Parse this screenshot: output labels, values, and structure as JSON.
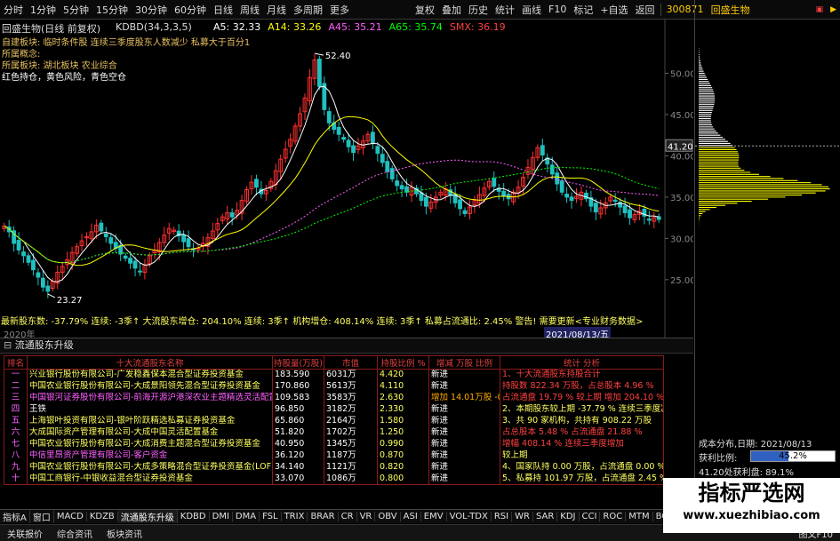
{
  "toolbar": {
    "periods": [
      "分时",
      "1分钟",
      "5分钟",
      "15分钟",
      "30分钟",
      "60分钟",
      "日线",
      "周线",
      "月线",
      "多周期",
      "更多"
    ],
    "actions": [
      "复权",
      "叠加",
      "历史",
      "统计",
      "画线",
      "F10",
      "标记",
      "+自选",
      "返回"
    ]
  },
  "stock": {
    "code": "300871",
    "name": "回盛生物"
  },
  "chart_info": {
    "main_title": "回盛生物(日线 前复权)",
    "indicator": "KDBD(34,3,3,5)",
    "ma": [
      {
        "label": "A5: 32.33",
        "color": "#ffffff"
      },
      {
        "label": "A14: 33.26",
        "color": "#ffff00"
      },
      {
        "label": "A45: 35.21",
        "color": "#ff60ff"
      },
      {
        "label": "A65: 35.74",
        "color": "#00ff00"
      },
      {
        "label": "SMX: 36.19",
        "color": "#ff4040"
      }
    ],
    "notes": [
      {
        "text": "自建板块: 临时条件股 连续三季度股东人数减少 私募大于百分1",
        "color": "#e8c060"
      },
      {
        "text": "所属概念:",
        "color": "#e8c060"
      },
      {
        "text": "所属板块: 湖北板块 农业综合",
        "color": "#e8c060"
      },
      {
        "text": "红色持仓，黄色风险，青色空仓",
        "color": "#ffffff"
      }
    ],
    "high_label": "52.40",
    "low_label": "23.27",
    "current_price_label": "41.20",
    "bottom_line": "最新股东数: -37.79% 连续: -3季↑ 大流股东增仓: 204.10% 连续: 3季↑ 机构增仓: 408.14% 连续: 3季↑ 私募占流通比: 2.45% 警告! 需要更新<专业财务数据>",
    "year_label": "2020年",
    "date_label": "2021/08/13/五"
  },
  "chart_data": {
    "type": "candlestick",
    "y_ticks": [
      25.0,
      30.0,
      35.0,
      40.0,
      45.0,
      50.0
    ],
    "ylim": [
      21,
      55
    ],
    "high": 52.4,
    "low": 23.27,
    "close_path": [
      31.5,
      30.8,
      29.4,
      28.6,
      27.9,
      27.1,
      26.2,
      25.3,
      24.1,
      23.6,
      24.8,
      25.9,
      26.6,
      27.4,
      28.3,
      29.0,
      29.7,
      30.2,
      30.8,
      31.6,
      30.9,
      30.2,
      29.4,
      28.8,
      28.1,
      27.6,
      27.0,
      26.4,
      26.0,
      26.8,
      27.9,
      28.6,
      29.5,
      30.4,
      31.2,
      31.0,
      30.3,
      29.6,
      29.0,
      28.6,
      28.8,
      29.4,
      30.1,
      30.9,
      31.8,
      32.6,
      33.1,
      32.6,
      33.4,
      34.6,
      35.9,
      36.8,
      36.2,
      35.4,
      35.8,
      36.9,
      38.2,
      39.6,
      40.8,
      42.0,
      43.6,
      45.1,
      47.0,
      49.5,
      51.6,
      48.4,
      45.6,
      44.0,
      43.2,
      42.6,
      42.0,
      41.1,
      40.4,
      41.2,
      41.8,
      42.6,
      41.5,
      40.3,
      39.2,
      38.1,
      37.2,
      36.4,
      36.0,
      35.6,
      36.2,
      35.4,
      34.6,
      33.9,
      34.4,
      35.0,
      35.6,
      36.0,
      35.2,
      34.3,
      33.6,
      33.0,
      33.8,
      34.6,
      35.3,
      36.1,
      36.9,
      36.3,
      35.7,
      35.1,
      34.8,
      35.6,
      36.2,
      37.4,
      38.6,
      39.8,
      41.0,
      40.1,
      39.0,
      37.8,
      36.6,
      35.6,
      35.0,
      34.6,
      35.1,
      35.6,
      34.8,
      33.9,
      33.2,
      33.7,
      34.3,
      35.0,
      34.5,
      33.8,
      33.1,
      32.5,
      32.9,
      33.3,
      32.7,
      32.2,
      32.5,
      32.3
    ],
    "volume_profile_peak": 36
  },
  "panel": {
    "title": "流通股东升级"
  },
  "holders": {
    "headers": [
      "排名",
      "十大流通股东名称",
      "持股量(万股)",
      "市值",
      "持股比例 %",
      "增减 万股 比例",
      "统计 分析"
    ],
    "rows": [
      {
        "rank": "一",
        "name": "兴业银行股份有限公司-广发稳鑫保本混合型证券投资基金",
        "name_color": "#ffff60",
        "qty": "183.590",
        "value": "6031万",
        "pct": "4.420",
        "change": "新进",
        "analysis": "1、十大流通股东持股合计",
        "analysis_color": "#ff4040"
      },
      {
        "rank": "二",
        "name": "中国农业银行股份有限公司-大成景阳领先混合型证券投资基金",
        "name_color": "#ffff60",
        "qty": "170.860",
        "value": "5613万",
        "pct": "4.110",
        "change": "新进",
        "analysis": "持股数 822.34 万股，占总股本 4.96 %",
        "analysis_color": "#ff4040"
      },
      {
        "rank": "三",
        "name": "中国银河证券股份有限公司-前海开源沪港深农业主题精选灵活配置混合型证券投资基金(LOF)",
        "name_color": "#ff60ff",
        "qty": "109.583",
        "value": "3583万",
        "pct": "2.630",
        "change": "增加 14.01万股 -0.2%",
        "analysis": "占流通盘 19.79 % 较上期 增加 204.10 % 连续",
        "analysis_color": "#ff4040"
      },
      {
        "rank": "四",
        "name": "王铁",
        "name_color": "#ffffff",
        "qty": "96.850",
        "value": "3182万",
        "pct": "2.330",
        "change": "新进",
        "analysis": "2、本期股东较上期 -37.79 % 连续三季度减少",
        "analysis_color": "#ffff60"
      },
      {
        "rank": "五",
        "name": "上海银叶投资有限公司-银叶阶跃精选私募证券投资基金",
        "name_color": "#ffff60",
        "qty": "65.860",
        "value": "2164万",
        "pct": "1.580",
        "change": "新进",
        "analysis": "3、共 90 家机构，共持有 908.22 万股",
        "analysis_color": "#ffff60"
      },
      {
        "rank": "六",
        "name": "大成国际资产管理有限公司-大成中国灵活配置基金",
        "name_color": "#ffff60",
        "qty": "51.820",
        "value": "1702万",
        "pct": "1.250",
        "change": "新进",
        "analysis": "占总股本 5.48 % 占流通盘 21.88 %",
        "analysis_color": "#ff4040"
      },
      {
        "rank": "七",
        "name": "中国农业银行股份有限公司-大成消费主题混合型证券投资基金",
        "name_color": "#ffff60",
        "qty": "40.950",
        "value": "1345万",
        "pct": "0.990",
        "change": "新进",
        "analysis": "增幅 408.14 % 连续三季度增加",
        "analysis_color": "#ff4040"
      },
      {
        "rank": "八",
        "name": "中信里昂资产管理有限公司-客户资金",
        "name_color": "#ff60ff",
        "qty": "36.120",
        "value": "1187万",
        "pct": "0.870",
        "change": "新进",
        "analysis": "较上期",
        "analysis_color": "#ffff60"
      },
      {
        "rank": "九",
        "name": "中国农业银行股份有限公司-大成多策略混合型证券投资基金(LOF)",
        "name_color": "#ffff60",
        "qty": "34.140",
        "value": "1121万",
        "pct": "0.820",
        "change": "新进",
        "analysis": "4、国家队持 0.00 万股，占流通盘 0.00 %",
        "analysis_color": "#ffff60"
      },
      {
        "rank": "十",
        "name": "中国工商银行-中银收益混合型证券投资基金",
        "name_color": "#ffff60",
        "qty": "33.070",
        "value": "1086万",
        "pct": "0.800",
        "change": "新进",
        "analysis": "5、私募持 101.97 万股，占流通盘 2.45 %",
        "analysis_color": "#ffff60"
      }
    ]
  },
  "bottom_tabs": [
    "指标A",
    "窗口",
    "MACD",
    "KDZB",
    "流通股东升级",
    "KDBD",
    "DMI",
    "DMA",
    "FSL",
    "TRIX",
    "BRAR",
    "CR",
    "VR",
    "OBV",
    "ASI",
    "EMV",
    "VOL-TDX",
    "RSI",
    "WR",
    "SAR",
    "KDJ",
    "CCI",
    "ROC",
    "MTM",
    "BOLL",
    "PSY",
    "MCST",
    "指标B",
    "模板"
  ],
  "status": {
    "left": [
      "关联报价",
      "综合资讯",
      "板块资讯"
    ],
    "right": "图文F10"
  },
  "right_panel": {
    "cost_date_label": "成本分布,日期: 2021/08/13",
    "profit_ratio_label": "获利比例:",
    "profit_ratio_value": "45.2%",
    "profit_at_label": "41.20处获利盘: 89.1%"
  },
  "watermark": {
    "title": "指标严选网",
    "url": "www.xuezhibiao.com"
  }
}
